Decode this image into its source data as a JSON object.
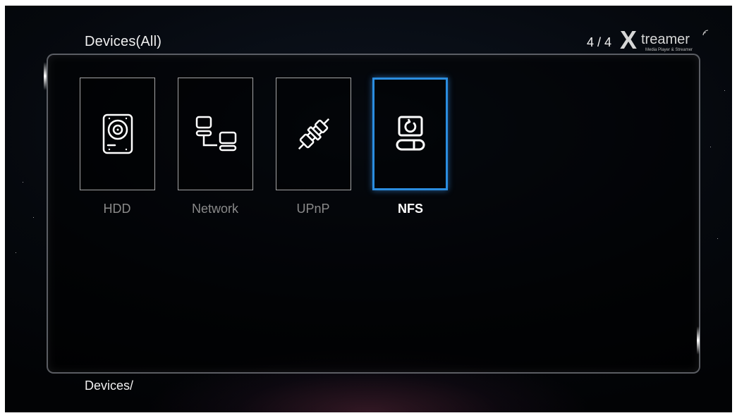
{
  "header": {
    "title": "Devices(All)",
    "counter": "4 / 4"
  },
  "logo": {
    "mark": "X",
    "word": "treamer",
    "tagline": "Media Player & Streamer"
  },
  "devices": [
    {
      "label": "HDD",
      "icon": "hard-drive-icon",
      "selected": false
    },
    {
      "label": "Network",
      "icon": "network-icon",
      "selected": false
    },
    {
      "label": "UPnP",
      "icon": "plug-connector-icon",
      "selected": false
    },
    {
      "label": "NFS",
      "icon": "nfs-share-icon",
      "selected": true
    }
  ],
  "footer": {
    "path": "Devices/"
  },
  "colors": {
    "selection": "#2b8de0",
    "text_primary": "#f0f0f0",
    "text_dim": "#8a8a8a",
    "background": "#05080d"
  }
}
